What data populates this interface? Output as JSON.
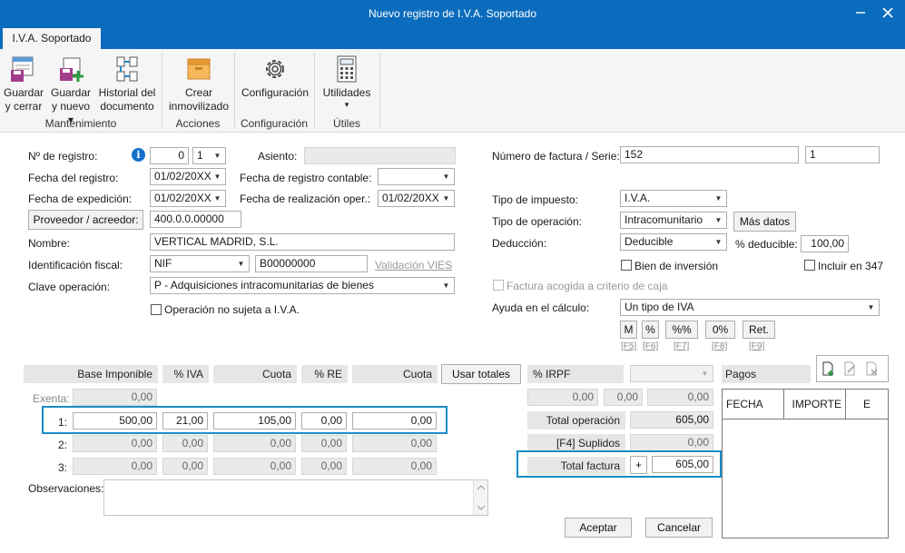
{
  "window": {
    "title": "Nuevo registro de I.V.A. Soportado",
    "minimize_icon": "minimize-icon",
    "close_icon": "close-icon"
  },
  "tab": {
    "label": "I.V.A. Soportado"
  },
  "ribbon": {
    "save_close": [
      "Guardar",
      "y cerrar"
    ],
    "save_new": [
      "Guardar",
      "y nuevo ▾"
    ],
    "history": [
      "Historial del",
      "documento"
    ],
    "create_fixed": [
      "Crear",
      "inmovilizado"
    ],
    "config": "Configuración",
    "utilities": "Utilidades",
    "utilities_arrow": "▾",
    "groups": {
      "mantenimiento": "Mantenimiento",
      "acciones": "Acciones",
      "configuracion": "Configuración",
      "utiles": "Útiles"
    }
  },
  "form": {
    "n_registro_label": "Nº de registro:",
    "n_registro": "0",
    "n_registro_serie": "1",
    "asiento_label": "Asiento:",
    "asiento": "",
    "fecha_registro_label": "Fecha del registro:",
    "fecha_registro": "01/02/20XX",
    "fecha_contable_label": "Fecha de registro contable:",
    "fecha_contable": "",
    "fecha_expedicion_label": "Fecha de expedición:",
    "fecha_expedicion": "01/02/20XX",
    "fecha_realizacion_label": "Fecha de realización oper.:",
    "fecha_realizacion": "01/02/20XX",
    "proveedor_button": "Proveedor / acreedor:",
    "proveedor": "400.0.0.00000",
    "nombre_label": "Nombre:",
    "nombre": "VERTICAL MADRID, S.L.",
    "ident_label": "Identificación fiscal:",
    "ident_tipo": "NIF",
    "ident_num": "B00000000",
    "vies_link": "Validación VIES",
    "clave_label": "Clave operación:",
    "clave": "P - Adquisiciones intracomunitarias de bienes",
    "no_sujeta_label": "Operación no sujeta a I.V.A.",
    "factura_label": "Número de factura / Serie:",
    "factura_num": "152",
    "factura_serie": "1",
    "tipo_impuesto_label": "Tipo de impuesto:",
    "tipo_impuesto": "I.V.A.",
    "tipo_operacion_label": "Tipo de operación:",
    "tipo_operacion": "Intracomunitario",
    "mas_datos": "Más datos",
    "deduccion_label": "Deducción:",
    "deduccion": "Deducible",
    "pct_deducible_label": "% deducible:",
    "pct_deducible": "100,00",
    "bien_inversion_label": "Bien de inversión",
    "incluir_347_label": "Incluir en 347",
    "criterio_caja_label": "Factura acogida a criterio de caja",
    "ayuda_label": "Ayuda en el cálculo:",
    "ayuda": "Un tipo de IVA",
    "calc_buttons": [
      {
        "label": "M",
        "key": "[F5]"
      },
      {
        "label": "%",
        "key": "[F6]"
      },
      {
        "label": "%%",
        "key": "[F7]"
      },
      {
        "label": "0%",
        "key": "[F8]"
      },
      {
        "label": "Ret.",
        "key": "[F9]"
      }
    ]
  },
  "grid": {
    "headers": {
      "base": "Base Imponible",
      "pct_iva": "% IVA",
      "cuota": "Cuota",
      "pct_re": "% RE",
      "cuota_re": "Cuota",
      "usar_totales": "Usar totales",
      "pct_irpf": "% IRPF"
    },
    "exenta_label": "Exenta:",
    "exenta": "0,00",
    "rows": [
      {
        "label": "1:",
        "base": "500,00",
        "pct_iva": "21,00",
        "cuota": "105,00",
        "pct_re": "0,00",
        "cuota_re": "0,00"
      },
      {
        "label": "2:",
        "base": "0,00",
        "pct_iva": "0,00",
        "cuota": "0,00",
        "pct_re": "0,00",
        "cuota_re": "0,00"
      },
      {
        "label": "3:",
        "base": "0,00",
        "pct_iva": "0,00",
        "cuota": "0,00",
        "pct_re": "0,00",
        "cuota_re": "0,00"
      }
    ],
    "irpf": {
      "base": "0,00",
      "pct": "0,00",
      "cuota": "0,00"
    },
    "total_operacion_label": "Total operación",
    "total_operacion": "605,00",
    "suplidos_label": "[F4] Suplidos",
    "suplidos": "0,00",
    "total_factura_label": "Total factura",
    "total_factura_sign": "+",
    "total_factura": "605,00"
  },
  "pagos": {
    "title": "Pagos",
    "columns": [
      "FECHA",
      "IMPORTE",
      "E"
    ]
  },
  "observaciones_label": "Observaciones:",
  "observaciones": "",
  "buttons": {
    "aceptar": "Aceptar",
    "cancelar": "Cancelar"
  },
  "colors": {
    "titlebar": "#0b6cbd",
    "highlight": "#1a8cc8"
  }
}
